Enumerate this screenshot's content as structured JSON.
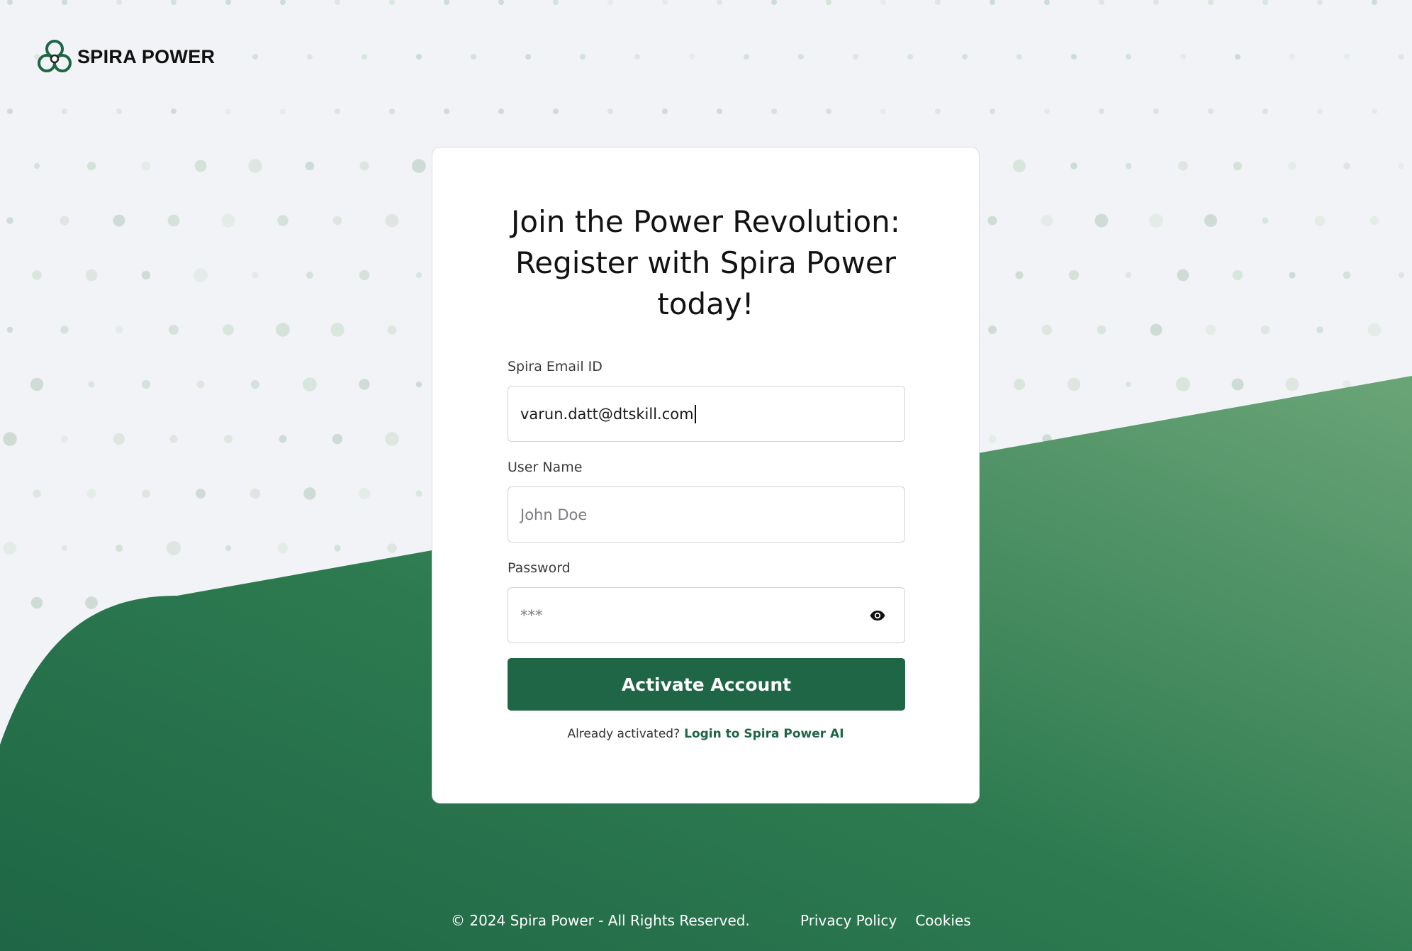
{
  "brand": {
    "name": "SPIRA POWER",
    "logo_icon": "spira-logo-icon",
    "primary_color": "#1e6645"
  },
  "card": {
    "title_lines": [
      "Join the Power Revolution:",
      "Register with Spira Power",
      "today!"
    ],
    "email": {
      "label": "Spira Email ID",
      "value": "varun.datt@dtskill.com"
    },
    "username": {
      "label": "User Name",
      "placeholder": "John Doe"
    },
    "password": {
      "label": "Password",
      "value": "***",
      "toggle_icon": "eye-icon"
    },
    "submit_label": "Activate Account",
    "login_prompt": "Already activated?",
    "login_link": "Login to Spira Power AI"
  },
  "footer": {
    "copyright": "© 2024 Spira Power - All Rights Reserved.",
    "links": [
      "Privacy Policy",
      "Cookies"
    ]
  }
}
